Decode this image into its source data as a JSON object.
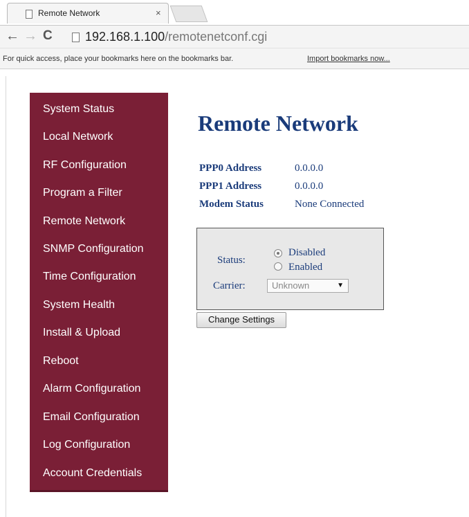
{
  "browser": {
    "tab_title": "Remote Network",
    "tab_close": "×",
    "url_host": "192.168.1.100",
    "url_path": "/remotenetconf.cgi",
    "bookmarks_message": "For quick access, place your bookmarks here on the bookmarks bar.",
    "bookmarks_link": "Import bookmarks now..."
  },
  "sidebar": {
    "color": "#7a1f36",
    "items": [
      {
        "label": "System Status"
      },
      {
        "label": "Local Network"
      },
      {
        "label": "RF Configuration"
      },
      {
        "label": "Program a Filter"
      },
      {
        "label": "Remote Network"
      },
      {
        "label": "SNMP Configuration"
      },
      {
        "label": "Time Configuration"
      },
      {
        "label": "System Health"
      },
      {
        "label": "Install & Upload"
      },
      {
        "label": "Reboot"
      },
      {
        "label": "Alarm Configuration"
      },
      {
        "label": "Email Configuration"
      },
      {
        "label": "Log Configuration"
      },
      {
        "label": "Account Credentials"
      }
    ]
  },
  "main": {
    "title": "Remote Network",
    "info": [
      {
        "label": "PPP0 Address",
        "value": "0.0.0.0"
      },
      {
        "label": "PPP1 Address",
        "value": "0.0.0.0"
      },
      {
        "label": "Modem Status",
        "value": "None Connected"
      }
    ],
    "settings": {
      "status_label": "Status:",
      "options": [
        {
          "label": "Disabled",
          "selected": true
        },
        {
          "label": "Enabled",
          "selected": false
        }
      ],
      "carrier_label": "Carrier:",
      "carrier_value": "Unknown"
    },
    "change_button": "Change Settings"
  },
  "colors": {
    "heading": "#1a3b7a",
    "sidebar": "#7a1f36"
  }
}
